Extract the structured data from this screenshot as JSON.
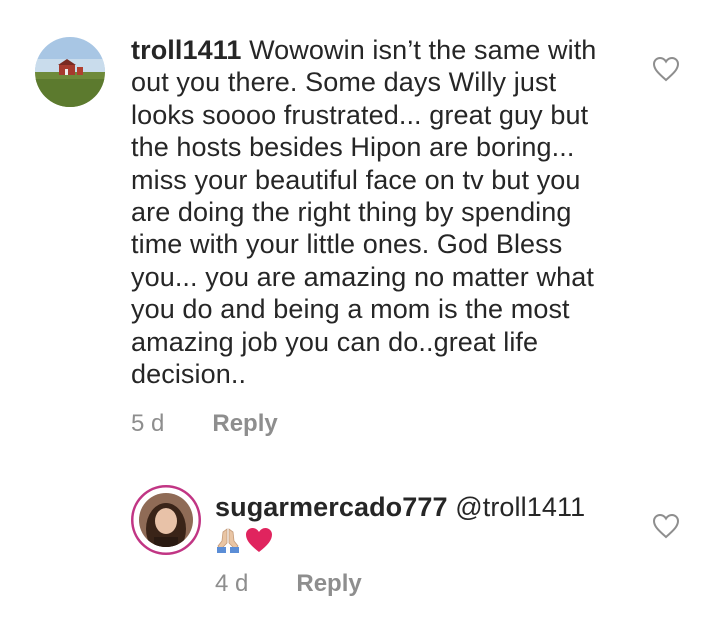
{
  "comments": [
    {
      "username": "troll1411",
      "text": " Wowowin isn’t the same with\nout you there. Some days Willy just\nlooks soooo frustrated... great guy but\nthe hosts besides Hipon are boring...\nmiss your beautiful face on tv but you\nare doing the right thing by spending\ntime with your little ones. God Bless\nyou... you are amazing no matter what\nyou do and being a mom is the most\namazing job you can do..great life\ndecision..",
      "time": "5 d",
      "reply_label": "Reply",
      "avatar_icon": "barn-landscape-avatar",
      "like_icon": "heart-outline-icon"
    },
    {
      "username": "sugarmercado777",
      "mention": "@troll1411",
      "emojis": [
        "🙏🏼",
        "❤️"
      ],
      "time": "4 d",
      "reply_label": "Reply",
      "avatar_icon": "profile-photo-avatar",
      "like_icon": "heart-outline-icon"
    }
  ],
  "colors": {
    "text": "#262626",
    "meta": "#8e8e8e",
    "heart_red": "#e0245e",
    "story_ring": "#c13584"
  }
}
